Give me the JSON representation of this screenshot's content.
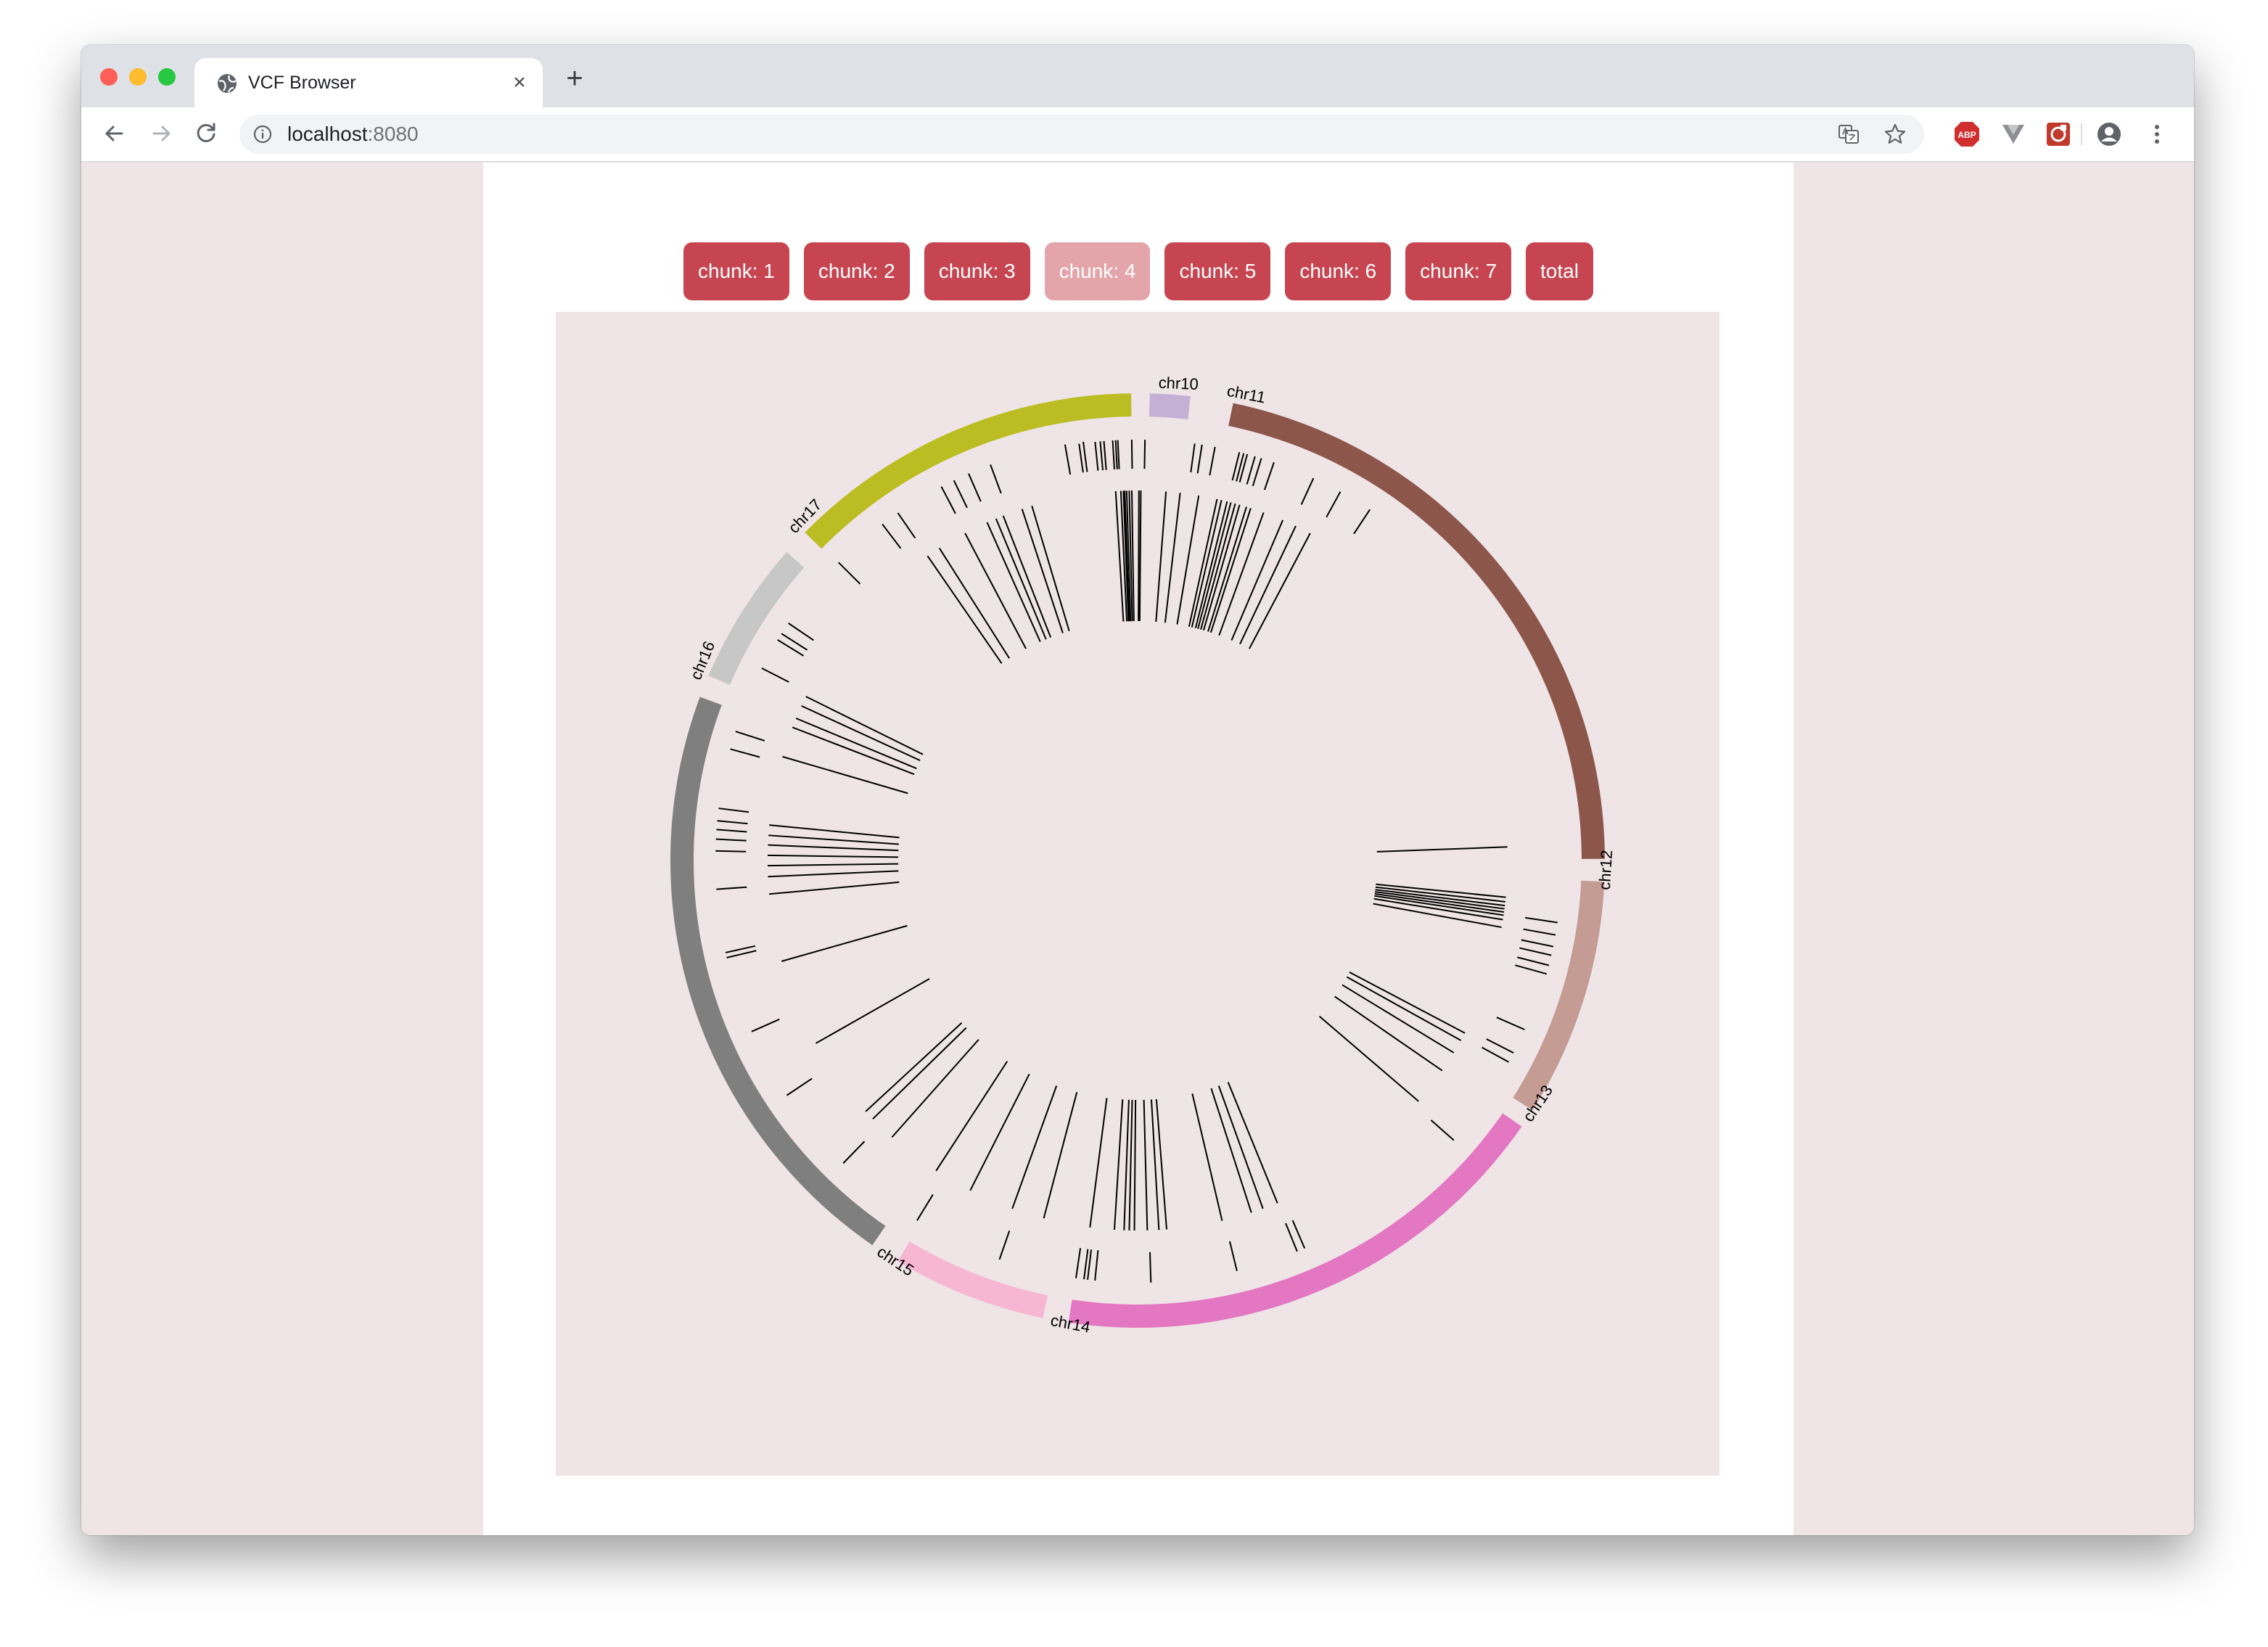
{
  "browser": {
    "tab_title": "VCF Browser",
    "url_host": "localhost",
    "url_port": ":8080",
    "favicon": "globe-icon",
    "extensions": [
      "translate-icon",
      "bookmark-star-icon",
      "adblock-icon",
      "vue-devtools-icon",
      "extension-icon",
      "profile-icon",
      "menu-icon"
    ]
  },
  "buttons": [
    {
      "label": "chunk: 1",
      "active": false
    },
    {
      "label": "chunk: 2",
      "active": false
    },
    {
      "label": "chunk: 3",
      "active": false
    },
    {
      "label": "chunk: 4",
      "active": true
    },
    {
      "label": "chunk: 5",
      "active": false
    },
    {
      "label": "chunk: 6",
      "active": false
    },
    {
      "label": "chunk: 7",
      "active": false
    },
    {
      "label": "total",
      "active": false
    }
  ],
  "colors": {
    "button": "#c64551",
    "button_active": "#e3a5aa",
    "plot_background": "#efe4e6",
    "page_background": "#efe4e6"
  },
  "chart_data": {
    "type": "circos",
    "chromosomes": [
      {
        "name": "chr10",
        "color": "#c5b0d5"
      },
      {
        "name": "chr11",
        "color": "#8c564b"
      },
      {
        "name": "chr12",
        "color": "#c49c94"
      },
      {
        "name": "chr13",
        "color": "#e377c2"
      },
      {
        "name": "chr14",
        "color": "#f7b6d2"
      },
      {
        "name": "chr15",
        "color": "#7f7f7f"
      },
      {
        "name": "chr16",
        "color": "#c7c7c7"
      },
      {
        "name": "chr17",
        "color": "#bcbd22"
      }
    ]
  }
}
